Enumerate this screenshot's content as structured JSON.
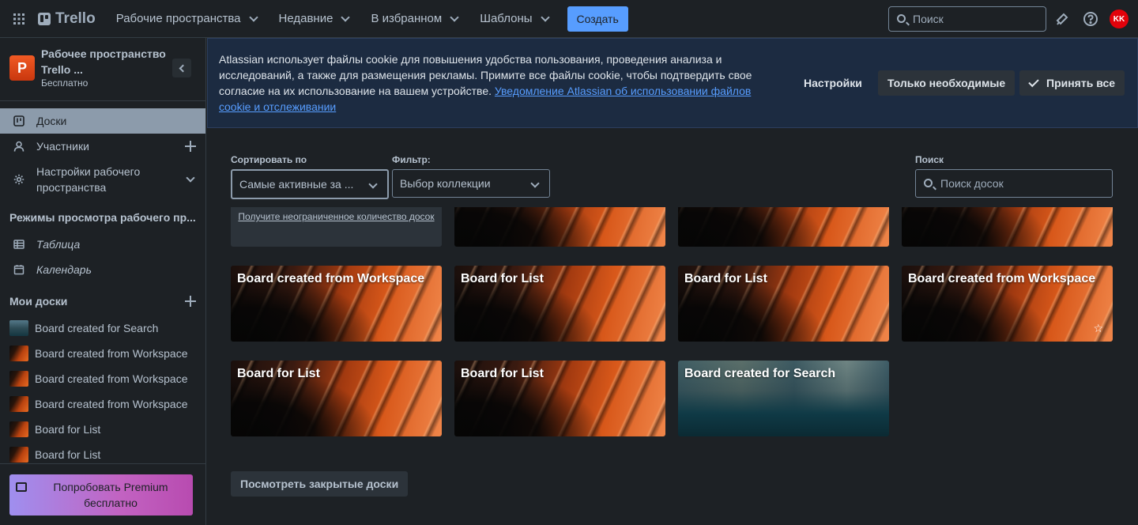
{
  "topbar": {
    "logo_text": "Trello",
    "nav": [
      {
        "label": "Рабочие пространства"
      },
      {
        "label": "Недавние"
      },
      {
        "label": "В избранном"
      },
      {
        "label": "Шаблоны"
      }
    ],
    "create_label": "Создать",
    "search_placeholder": "Поиск",
    "avatar_initials": "KK"
  },
  "sidebar": {
    "workspace_letter": "P",
    "workspace_name": "Рабочее пространство Trello ...",
    "workspace_plan": "Бесплатно",
    "items": [
      {
        "label": "Доски",
        "icon": "board-icon"
      },
      {
        "label": "Участники",
        "icon": "person-icon"
      },
      {
        "label": "Настройки рабочего пространства",
        "icon": "gear-icon"
      }
    ],
    "views_heading": "Режимы просмотра рабочего пр...",
    "views": [
      {
        "label": "Таблица",
        "icon": "table-icon"
      },
      {
        "label": "Календарь",
        "icon": "calendar-icon"
      }
    ],
    "my_boards_heading": "Мои доски",
    "boards": [
      {
        "label": "Board created for Search",
        "thumb": "venice"
      },
      {
        "label": "Board created from Workspace",
        "thumb": "orange"
      },
      {
        "label": "Board created from Workspace",
        "thumb": "orange"
      },
      {
        "label": "Board created from Workspace",
        "thumb": "orange"
      },
      {
        "label": "Board for List",
        "thumb": "orange"
      },
      {
        "label": "Board for List",
        "thumb": "orange"
      }
    ],
    "premium_label": "Попробовать Premium бесплатно"
  },
  "cookie": {
    "text": "Atlassian использует файлы cookie для повышения удобства пользования, проведения анализа и исследований, а также для размещения рекламы. Примите все файлы cookie, чтобы подтвердить свое согласие на их использование на вашем устройстве. ",
    "link_text": "Уведомление Atlassian об использовании файлов cookie и отслеживании",
    "settings_label": "Настройки",
    "necessary_label": "Только необходимые",
    "accept_label": "Принять все"
  },
  "main": {
    "sort_label": "Сортировать по",
    "sort_value": "Самые активные за ...",
    "filter_label": "Фильтр:",
    "filter_value": "Выбор коллекции",
    "search_label": "Поиск",
    "search_placeholder": "Поиск досок",
    "promo_text": "Получите неограниченное количество досок",
    "boards": [
      {
        "title": "Board created from Workspace",
        "bg": "orange"
      },
      {
        "title": "Board for List",
        "bg": "orange"
      },
      {
        "title": "Board for List",
        "bg": "orange"
      },
      {
        "title": "Board created from Workspace",
        "bg": "orange",
        "star": "☆"
      },
      {
        "title": "Board for List",
        "bg": "orange"
      },
      {
        "title": "Board for List",
        "bg": "orange"
      },
      {
        "title": "Board created for Search",
        "bg": "venice"
      }
    ],
    "closed_boards_label": "Посмотреть закрытые доски"
  },
  "colors": {
    "accent": "#579dff",
    "workspace_badge": "#f15a24",
    "avatar": "#e2020b",
    "sidebar_active": "#8c9bab"
  }
}
